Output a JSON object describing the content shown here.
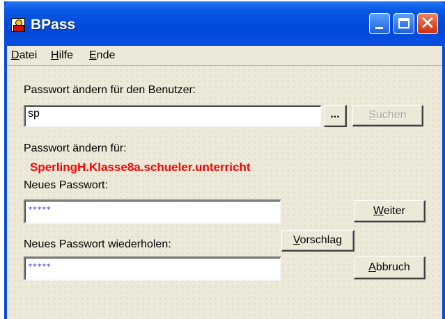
{
  "window": {
    "title": "BPass"
  },
  "menu": [
    {
      "mnemonic": "D",
      "rest": "atei"
    },
    {
      "mnemonic": "H",
      "rest": "ilfe"
    },
    {
      "mnemonic": "E",
      "rest": "nde"
    }
  ],
  "form": {
    "user_label": "Passwort ändern für den Benutzer:",
    "user_value": "sp",
    "browse_label": "...",
    "search_mnemonic": "S",
    "search_rest": "uchen",
    "target_label": "Passwort ändern für:",
    "target_value": "SperlingH.Klasse8a.schueler.unterricht",
    "new_pw_label": "Neues Passwort:",
    "new_pw_value": "*****",
    "repeat_pw_label": "Neues Passwort wiederholen:",
    "repeat_pw_value": "*****",
    "suggest_mnemonic": "V",
    "suggest_rest": "orschlag",
    "next_mnemonic": "W",
    "next_rest": "eiter",
    "cancel_mnemonic": "A",
    "cancel_rest": "bbruch"
  }
}
